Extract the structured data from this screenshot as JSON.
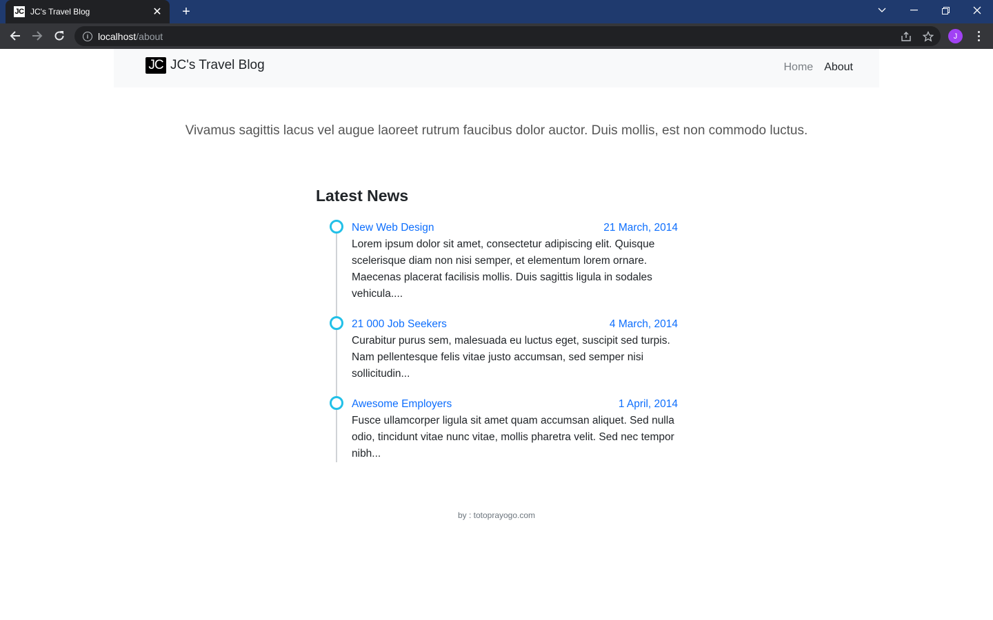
{
  "browser": {
    "tab_favicon": "JC",
    "tab_title": "JC's Travel Blog",
    "url_host": "localhost",
    "url_path": "/about",
    "profile_initial": "J"
  },
  "navbar": {
    "brand_logo": "JC",
    "brand_text": "JC's Travel Blog",
    "links": [
      {
        "label": "Home"
      },
      {
        "label": "About"
      }
    ]
  },
  "lead": "Vivamus sagittis lacus vel augue laoreet rutrum faucibus dolor auctor. Duis mollis, est non commodo luctus.",
  "news": {
    "title": "Latest News",
    "items": [
      {
        "title": "New Web Design",
        "date": "21 March, 2014",
        "text": "Lorem ipsum dolor sit amet, consectetur adipiscing elit. Quisque scelerisque diam non nisi semper, et elementum lorem ornare. Maecenas placerat facilisis mollis. Duis sagittis ligula in sodales vehicula...."
      },
      {
        "title": "21 000 Job Seekers",
        "date": "4 March, 2014",
        "text": "Curabitur purus sem, malesuada eu luctus eget, suscipit sed turpis. Nam pellentesque felis vitae justo accumsan, sed semper nisi sollicitudin..."
      },
      {
        "title": "Awesome Employers",
        "date": "1 April, 2014",
        "text": "Fusce ullamcorper ligula sit amet quam accumsan aliquet. Sed nulla odio, tincidunt vitae nunc vitae, mollis pharetra velit. Sed nec tempor nibh..."
      }
    ]
  },
  "footer": "by : totoprayogo.com",
  "colors": {
    "tabbar": "#1f3a6e",
    "timeline_dot": "#22c0e8",
    "link": "#0d6efd"
  }
}
